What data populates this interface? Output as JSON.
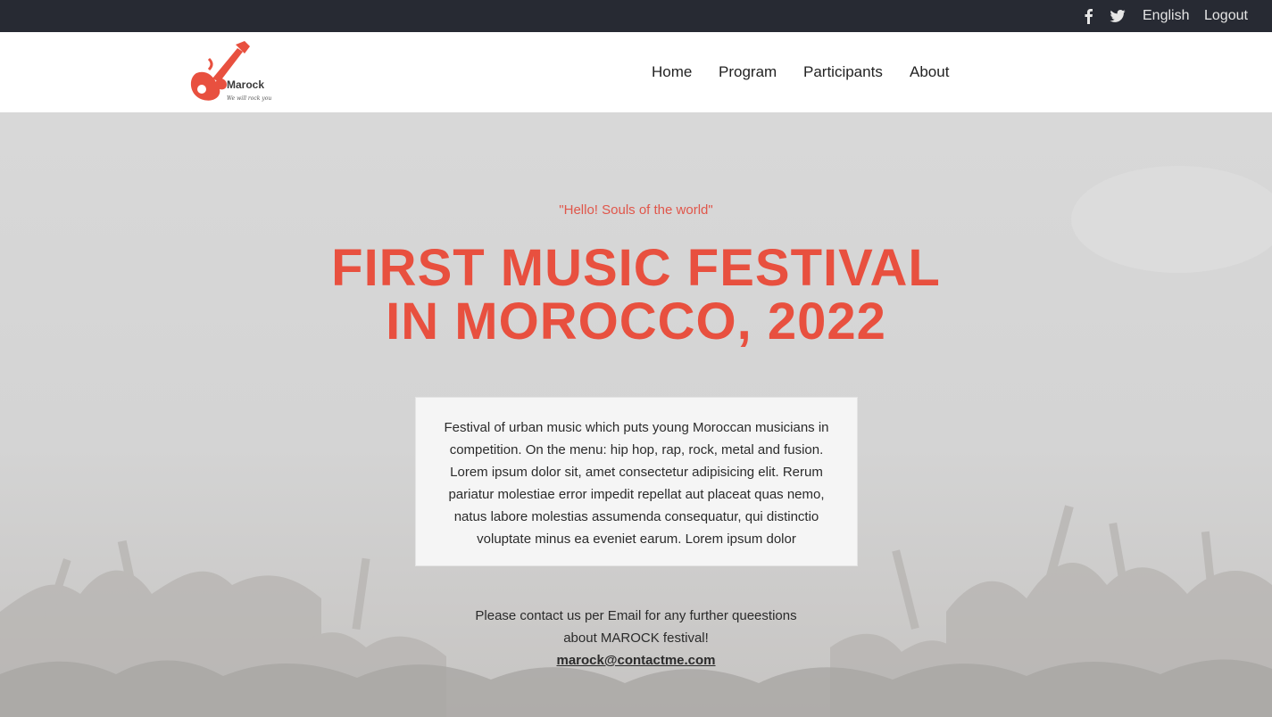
{
  "topbar": {
    "icons": [
      "facebook-icon",
      "twitter-icon"
    ],
    "language": "English",
    "logout": "Logout",
    "bg_color": "#272a33"
  },
  "logo": {
    "name": "Marock",
    "tagline": "We will rock you",
    "accent_color": "#e8503f"
  },
  "nav": {
    "items": [
      "Home",
      "Program",
      "Participants",
      "About"
    ]
  },
  "hero": {
    "tagline": "\"Hello! Souls of the world\"",
    "headline_line1": "FIRST MUSIC FESTIVAL",
    "headline_line2": "IN MOROCCO, 2022",
    "description": "Festival of urban music which puts young Moroccan musicians in competition. On the menu: hip hop, rap, rock, metal and fusion. Lorem ipsum dolor sit, amet consectetur adipisicing elit. Rerum pariatur molestiae error impedit repellat aut placeat quas nemo, natus labore molestias assumenda consequatur, qui distinctio voluptate minus ea eveniet earum. Lorem ipsum dolor",
    "headline_color": "#e8503f"
  },
  "contact": {
    "line1": "Please contact us per Email for any further queestions",
    "line2": "about MAROCK festival!",
    "email": "marock@contactme.com"
  }
}
